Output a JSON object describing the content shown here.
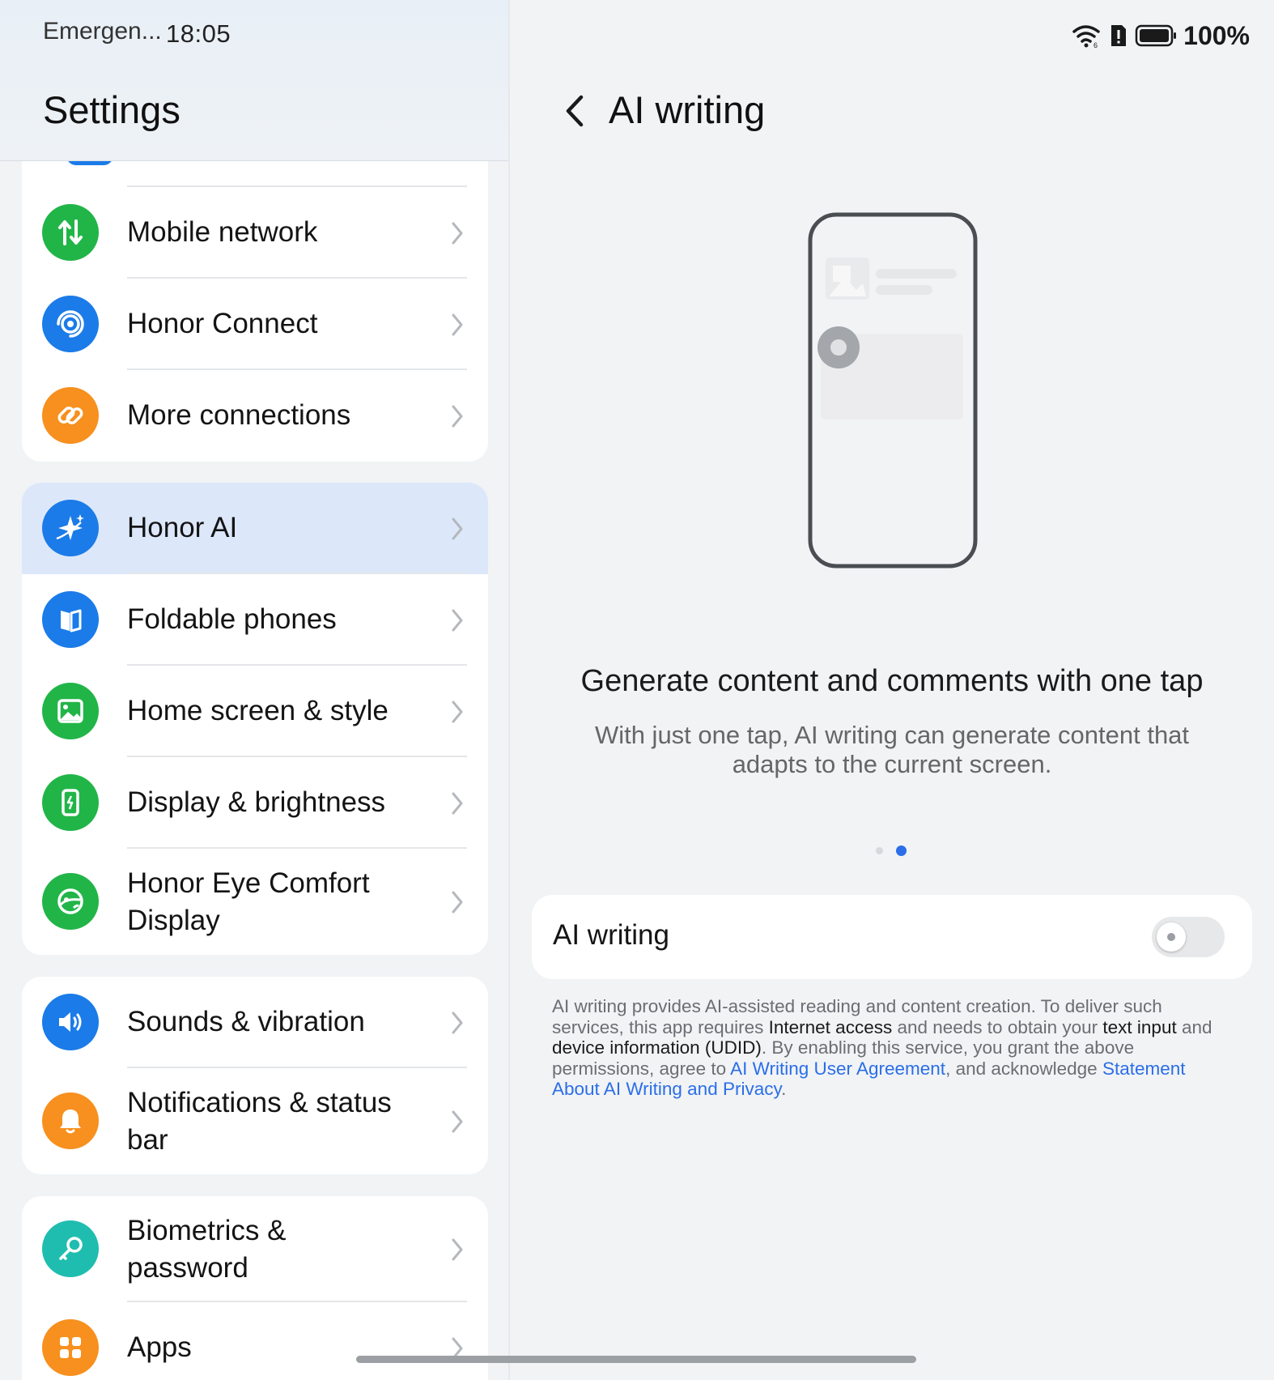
{
  "status_bar": {
    "carrier": "Emergen...",
    "time": "18:05",
    "battery": "100%"
  },
  "left": {
    "title": "Settings",
    "groups": [
      {
        "items": [
          {
            "label": "Mobile network",
            "icon": "mobile-data-icon",
            "color": "#21b548"
          },
          {
            "label": "Honor Connect",
            "icon": "honor-connect-icon",
            "color": "#1b7be8"
          },
          {
            "label": "More connections",
            "icon": "link-icon",
            "color": "#f7901e"
          }
        ]
      },
      {
        "items": [
          {
            "label": "Honor AI",
            "icon": "sparkle-icon",
            "color": "#1b7be8",
            "selected": true
          },
          {
            "label": "Foldable phones",
            "icon": "foldable-icon",
            "color": "#1b7be8"
          },
          {
            "label": "Home screen & style",
            "icon": "image-icon",
            "color": "#21b548"
          },
          {
            "label": "Display & brightness",
            "icon": "display-icon",
            "color": "#21b548"
          },
          {
            "label": "Honor Eye Comfort Display",
            "icon": "eye-comfort-icon",
            "color": "#21b548"
          }
        ]
      },
      {
        "items": [
          {
            "label": "Sounds & vibration",
            "icon": "speaker-icon",
            "color": "#1b7be8"
          },
          {
            "label": "Notifications & status bar",
            "icon": "bell-icon",
            "color": "#f7901e"
          }
        ]
      },
      {
        "items": [
          {
            "label": "Biometrics & password",
            "icon": "key-icon",
            "color": "#1fbdb0"
          },
          {
            "label": "Apps",
            "icon": "apps-icon",
            "color": "#f7901e"
          }
        ]
      }
    ]
  },
  "right": {
    "title": "AI writing",
    "promo_title": "Generate content and comments with one tap",
    "promo_desc": "With just one tap, AI writing can generate content that adapts to the current screen.",
    "page_indicator": {
      "count": 2,
      "active": 2
    },
    "toggle": {
      "label": "AI writing",
      "on": false
    },
    "disclaimer": {
      "t1": "AI writing provides AI-assisted reading and content creation. To deliver such services, this app requires ",
      "b1": "Internet access",
      "t2": " and needs to obtain your ",
      "b2": "text input",
      "t3": " and ",
      "b3": "device information (UDID)",
      "t4": ". By enabling this service, you grant the above permissions, agree to ",
      "l1": "AI Writing User Agreement",
      "t5": ", and acknowledge ",
      "l2": "Statement About AI Writing and Privacy",
      "t6": "."
    }
  },
  "colors": {
    "accent": "#2b6ee8",
    "selected_row": "#dce8fa",
    "background": "#f1f3f5"
  }
}
